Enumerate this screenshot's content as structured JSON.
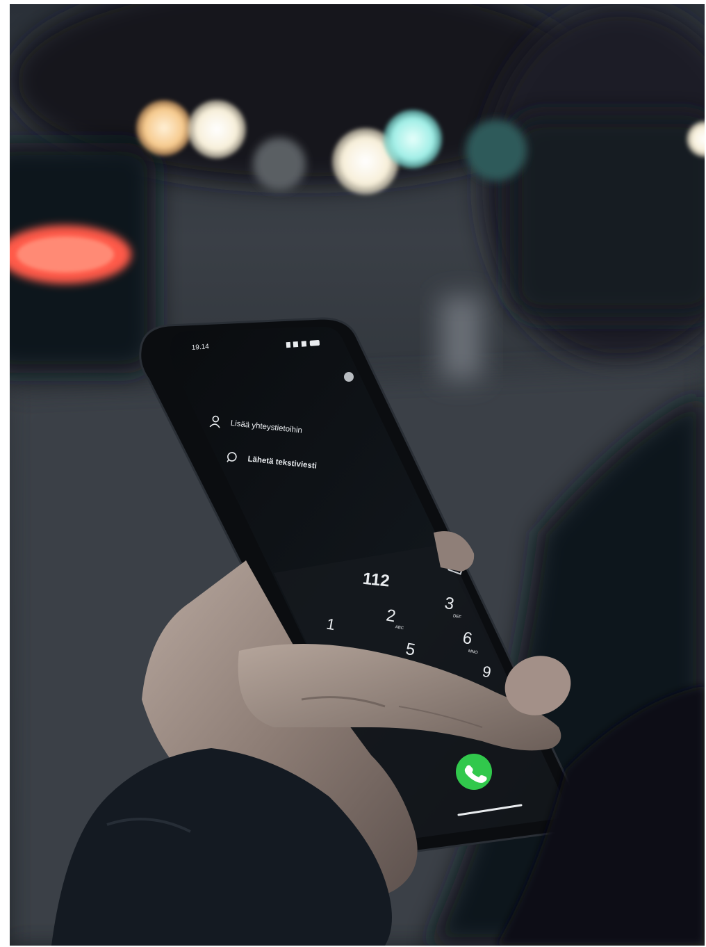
{
  "colors": {
    "sky_dark": "#1b2128",
    "road": "#2c3137",
    "bokeh_warm": "#f7c98a",
    "bokeh_cyan": "#a7f1ea",
    "taillight": "#ff5a4a",
    "phone_body": "#0b0d10",
    "screen": "#050607",
    "call_green": "#31c84c",
    "skin": "#9a8c84",
    "sleeve": "#141a22"
  },
  "phone": {
    "status_time": "19.14",
    "status_right": "",
    "menu": [
      {
        "icon": "add-contact-icon",
        "label": "Lisää yhteystietoihin"
      },
      {
        "icon": "message-icon",
        "label": "Lähetä tekstiviesti"
      }
    ],
    "dialed_number": "112",
    "keys": [
      {
        "digit": "1",
        "letters": ""
      },
      {
        "digit": "2",
        "letters": "ABC"
      },
      {
        "digit": "3",
        "letters": "DEF"
      },
      {
        "digit": "5",
        "letters": ""
      },
      {
        "digit": "6",
        "letters": "MNO"
      },
      {
        "digit": "9",
        "letters": ""
      }
    ],
    "call_button_icon": "phone-icon",
    "backspace_icon": "backspace-icon"
  }
}
